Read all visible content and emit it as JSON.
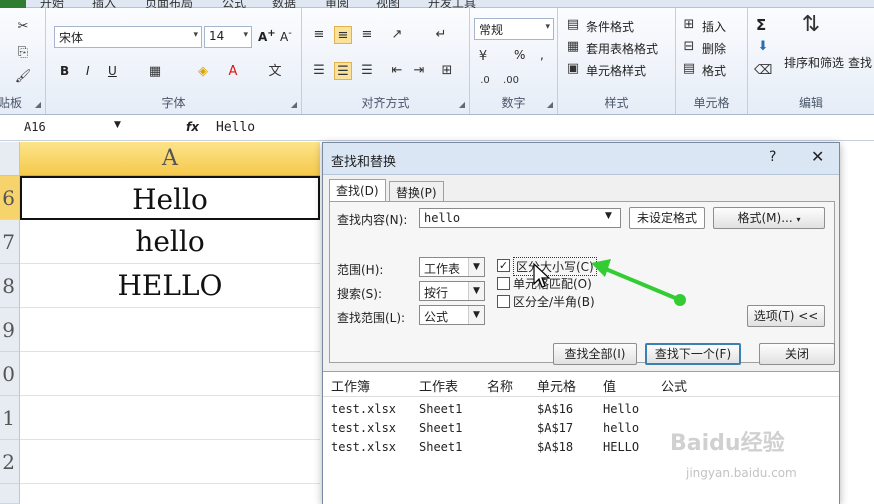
{
  "ribbon": {
    "tabs": [
      "开始",
      "插入",
      "页面布局",
      "公式",
      "数据",
      "审阅",
      "视图",
      "开发工具"
    ],
    "clipboard_label": "剪贴板",
    "font": {
      "name": "宋体",
      "size": "14",
      "label": "字体",
      "bold": "B",
      "italic": "I",
      "underline": "U"
    },
    "alignment_label": "对齐方式",
    "number": {
      "format": "常规",
      "label": "数字",
      "percent": "%",
      "comma": ","
    },
    "styles": {
      "conditional": "条件格式",
      "table": "套用表格格式",
      "cell": "单元格样式",
      "label": "样式"
    },
    "cells": {
      "insert": "插入",
      "delete": "删除",
      "format": "格式",
      "label": "单元格"
    },
    "editing": {
      "sum": "Σ",
      "sort": "排序和筛选",
      "find": "查找",
      "label": "编辑"
    }
  },
  "formula_bar": {
    "name_box": "A16",
    "fx": "fx",
    "value": "Hello"
  },
  "sheet": {
    "column_header": "A",
    "rows": [
      {
        "num": "6",
        "value": "Hello"
      },
      {
        "num": "7",
        "value": "hello"
      },
      {
        "num": "8",
        "value": "HELLO"
      },
      {
        "num": "9",
        "value": ""
      },
      {
        "num": "0",
        "value": ""
      },
      {
        "num": "1",
        "value": ""
      },
      {
        "num": "2",
        "value": ""
      }
    ]
  },
  "dialog": {
    "title": "查找和替换",
    "help": "?",
    "close": "✕",
    "tabs": [
      "查找(D)",
      "替换(P)"
    ],
    "find_label": "查找内容(N):",
    "find_value": "hello",
    "no_format_btn": "未设定格式",
    "format_btn": "格式(M)...",
    "scope_label": "范围(H):",
    "scope_value": "工作表",
    "search_label": "搜索(S):",
    "search_value": "按行",
    "lookin_label": "查找范围(L):",
    "lookin_value": "公式",
    "match_case": "区分大小写(C)",
    "match_entire": "单元格匹配(O)",
    "match_width": "区分全/半角(B)",
    "options_btn": "选项(T) <<",
    "find_all_btn": "查找全部(I)",
    "find_next_btn": "查找下一个(F)",
    "close_btn": "关闭",
    "results": {
      "headers": [
        "工作簿",
        "工作表",
        "名称",
        "单元格",
        "值",
        "公式"
      ],
      "rows": [
        [
          "test.xlsx",
          "Sheet1",
          "",
          "$A$16",
          "Hello",
          ""
        ],
        [
          "test.xlsx",
          "Sheet1",
          "",
          "$A$17",
          "hello",
          ""
        ],
        [
          "test.xlsx",
          "Sheet1",
          "",
          "$A$18",
          "HELLO",
          ""
        ]
      ]
    }
  },
  "watermark": {
    "brand": "Baidu经验",
    "url": "jingyan.baidu.com"
  },
  "colors": {
    "arrow": "#33cc33",
    "selected_header": "#f5c94c",
    "default_button": "#3c7fb1"
  }
}
